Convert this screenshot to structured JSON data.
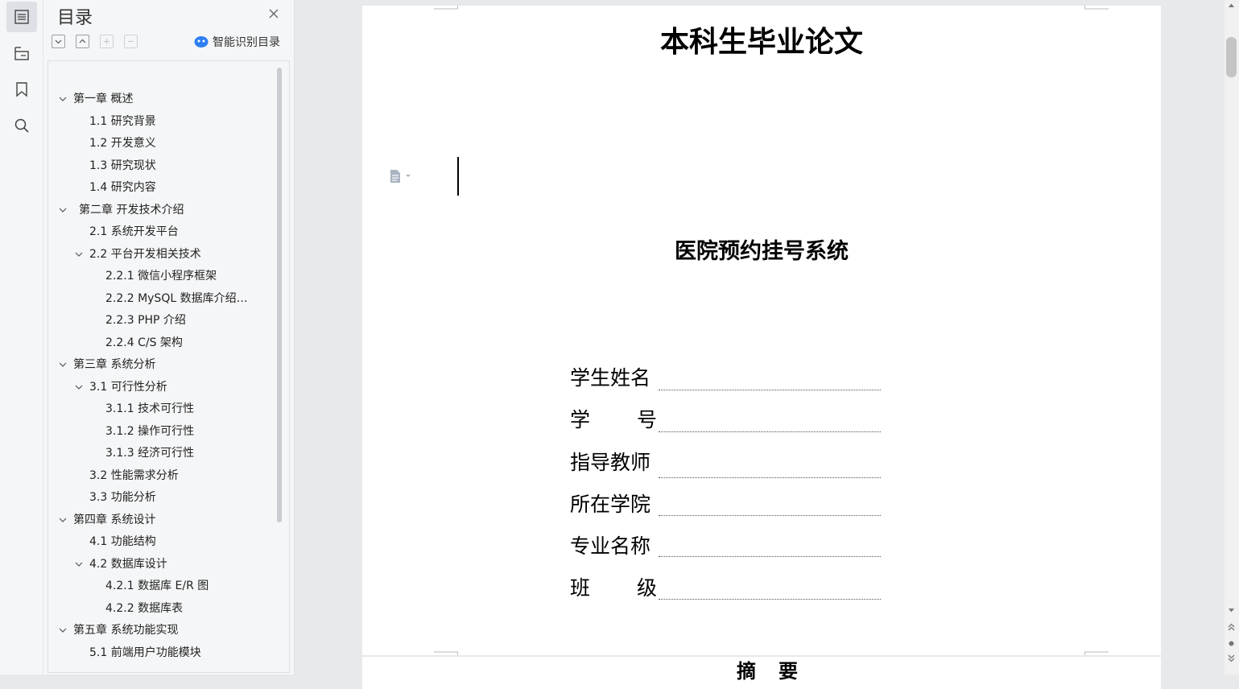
{
  "toc": {
    "title": "目录",
    "smart_label": "智能识别目录",
    "items": [
      "第一章  概述",
      "1.1  研究背景",
      "1.2  开发意义",
      "1.3  研究现状",
      "1.4  研究内容",
      "第二章  开发技术介绍",
      "2.1  系统开发平台",
      "2.2  平台开发相关技术",
      "2.2.1    微信小程序框架",
      "2.2.2    MySQL 数据库介绍…",
      "2.2.3    PHP 介绍",
      "2.2.4    C/S 架构",
      "第三章  系统分析",
      "3.1  可行性分析",
      "3.1.1  技术可行性",
      "3.1.2  操作可行性",
      "3.1.3 经济可行性",
      "3.2 性能需求分析",
      "3.3 功能分析",
      "第四章  系统设计",
      "4.1 功能结构",
      "4.2  数据库设计",
      "4.2.1  数据库 E/R 图",
      "4.2.2  数据库表",
      "第五章  系统功能实现",
      "5.1 前端用户功能模块"
    ]
  },
  "document": {
    "title": "本科生毕业论文",
    "subtitle": "医院预约挂号系统",
    "fields": [
      "学生姓名",
      "学号",
      "指导教师",
      "所在学院",
      "专业名称",
      "班级"
    ],
    "next_heading": "摘要"
  }
}
